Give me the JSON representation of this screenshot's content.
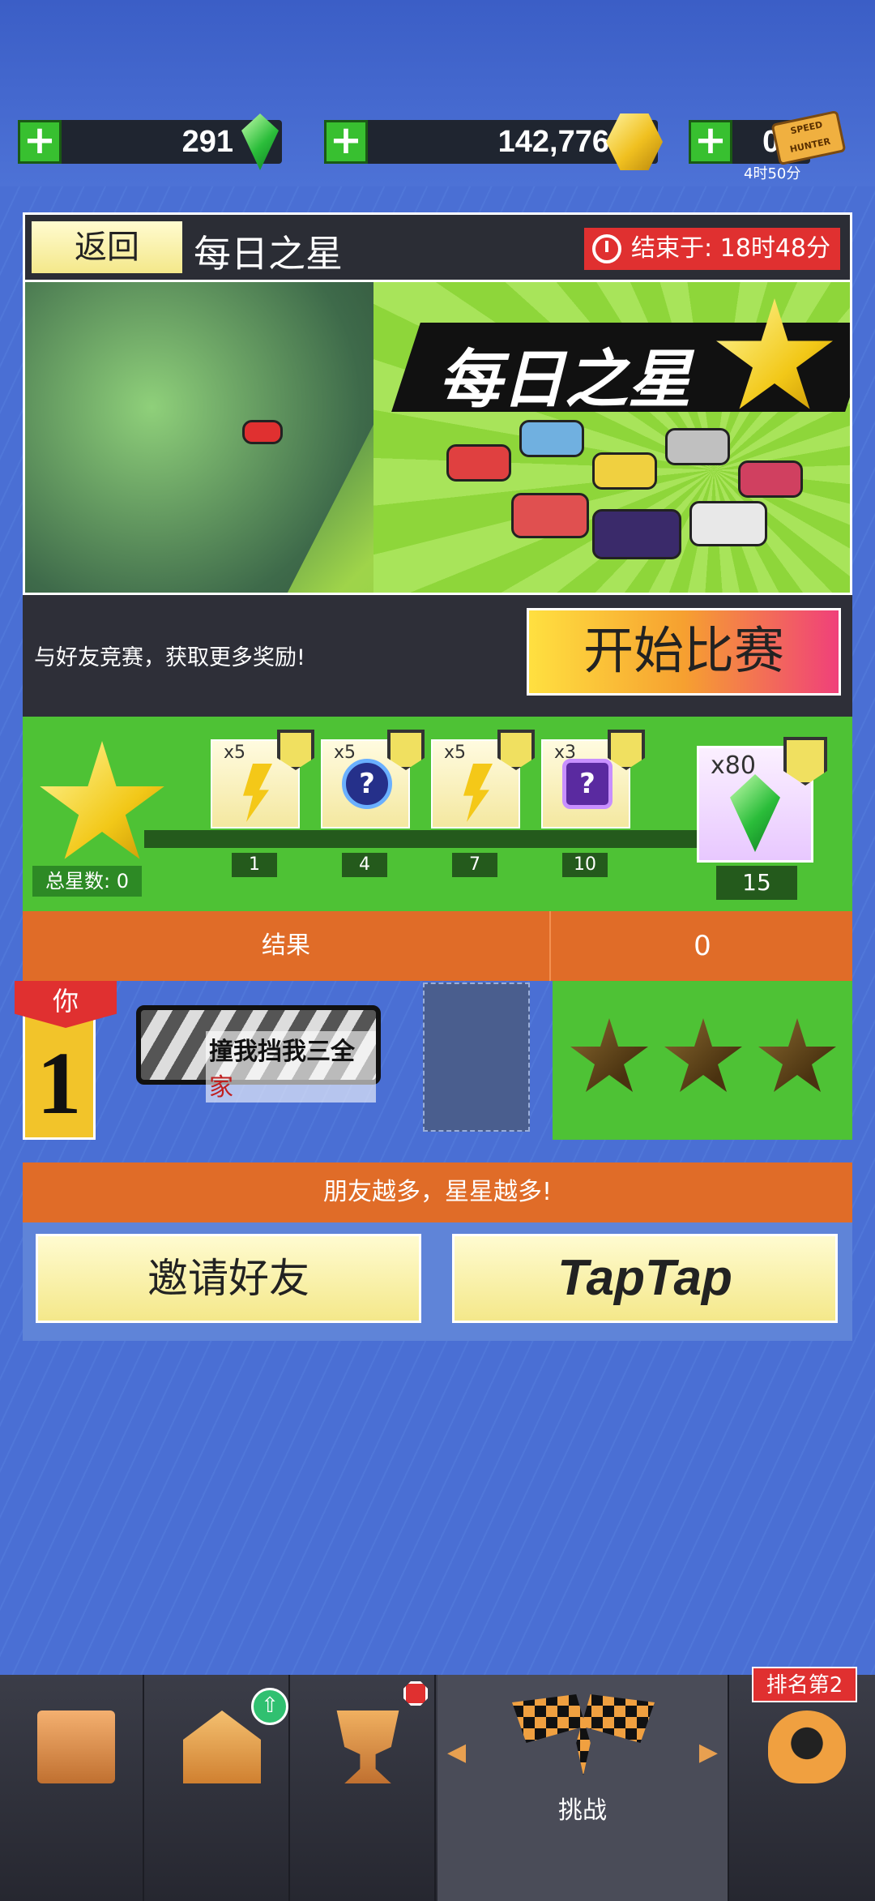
{
  "currency": {
    "gems": "291",
    "coins": "142,776",
    "tickets": "0/3",
    "ticket_timer": "4时50分",
    "ticket_brand": "SPEED HUNTER"
  },
  "header": {
    "back_label": "返回",
    "title": "每日之星",
    "ends_label": "结束于:",
    "ends_time": "18时48分"
  },
  "banner": {
    "title": "每日之星"
  },
  "info": {
    "tagline": "与好友竞赛，获取更多奖励!",
    "start_label": "开始比赛"
  },
  "progress": {
    "total_label": "总星数:",
    "total_value": "0",
    "rewards": [
      {
        "qty": "x5",
        "type": "bolt",
        "milestone": "1"
      },
      {
        "qty": "x5",
        "type": "mystery-blue",
        "milestone": "4"
      },
      {
        "qty": "x5",
        "type": "bolt",
        "milestone": "7"
      },
      {
        "qty": "x3",
        "type": "mystery-purple",
        "milestone": "10"
      }
    ],
    "final_reward": {
      "qty": "x80",
      "type": "gem",
      "milestone": "15"
    }
  },
  "results": {
    "header_label": "结果",
    "header_value": "0",
    "player": {
      "tag": "你",
      "rank": "1",
      "plate_text_a": "撞我挡我三全",
      "plate_text_b": "家"
    },
    "stars_earned": 0,
    "stars_total": 3
  },
  "friends": {
    "slogan": "朋友越多，星星越多!",
    "invite_label": "邀请好友",
    "taptap_label": "TapTap"
  },
  "nav": {
    "challenge_label": "挑战",
    "rank_label": "排名第2",
    "up_glyph": "⇧"
  },
  "colors": {
    "accent_orange": "#e06c28",
    "accent_green": "#4ec235",
    "alert_red": "#e03030"
  }
}
